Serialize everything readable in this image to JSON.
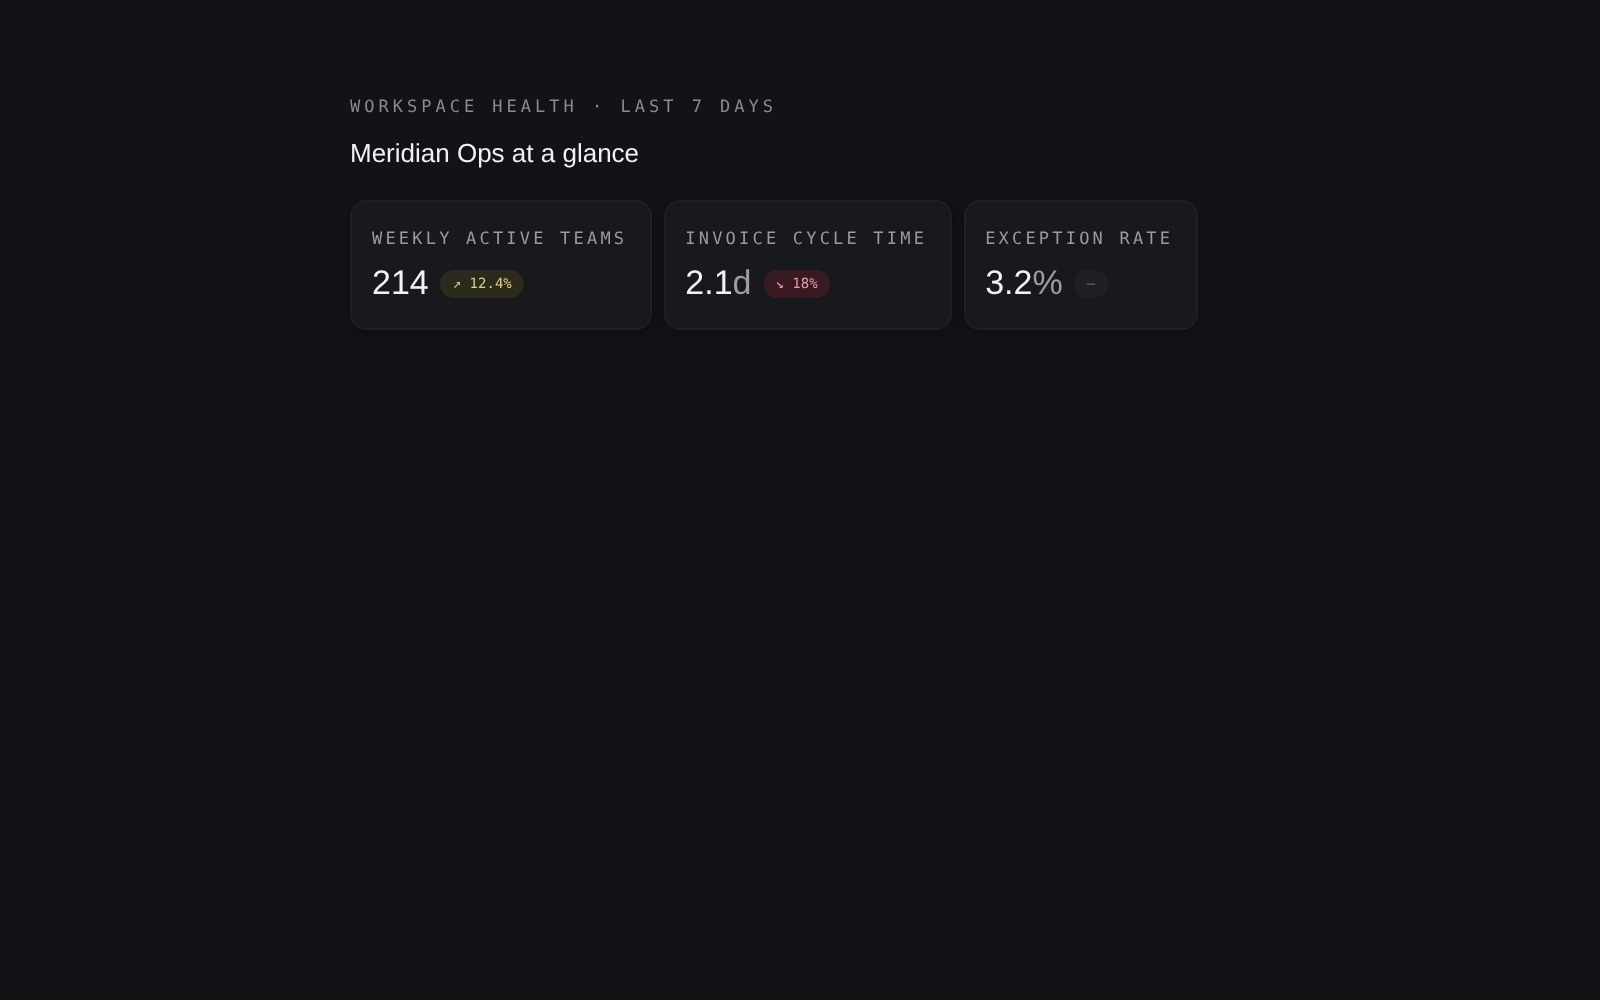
{
  "eyebrow": "WORKSPACE HEALTH · LAST 7 DAYS",
  "title": "Meridian Ops at a glance",
  "metrics": [
    {
      "label": "WEEKLY ACTIVE TEAMS",
      "value": "214",
      "badge": {
        "kind": "up",
        "icon": "↗",
        "text": "12.4%"
      }
    },
    {
      "label": "INVOICE CYCLE TIME",
      "value": "2.1",
      "unit": "d",
      "badge": {
        "kind": "down",
        "icon": "↘",
        "text": "18%"
      }
    },
    {
      "label": "EXCEPTION RATE",
      "value": "3.2",
      "unit": "%",
      "badge": {
        "kind": "flat",
        "icon": "–"
      }
    }
  ]
}
